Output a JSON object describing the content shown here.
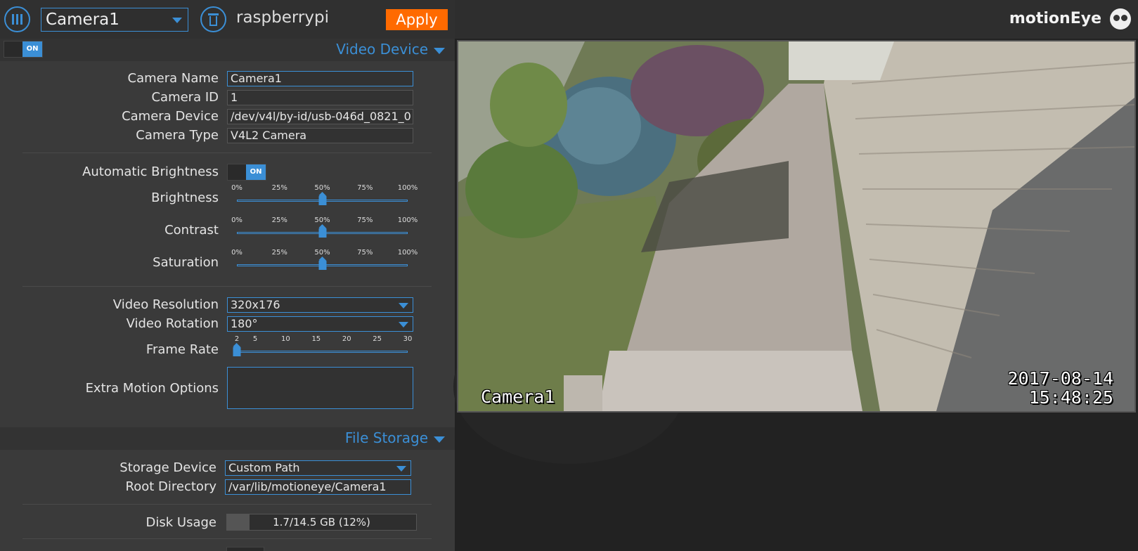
{
  "topbar": {
    "camera_select": "Camera1",
    "host": "raspberrypi",
    "apply": "Apply"
  },
  "brand": {
    "name": "motionEye"
  },
  "camera_enabled": "ON",
  "video_device": {
    "title": "Video Device",
    "camera_name_label": "Camera Name",
    "camera_name": "Camera1",
    "camera_id_label": "Camera ID",
    "camera_id": "1",
    "camera_device_label": "Camera Device",
    "camera_device": "/dev/v4l/by-id/usb-046d_0821_0",
    "camera_type_label": "Camera Type",
    "camera_type": "V4L2 Camera",
    "auto_brightness_label": "Automatic Brightness",
    "auto_brightness": "ON",
    "brightness_label": "Brightness",
    "brightness": 50,
    "contrast_label": "Contrast",
    "contrast": 50,
    "saturation_label": "Saturation",
    "saturation": 50,
    "percent_ticks": [
      "0%",
      "25%",
      "50%",
      "75%",
      "100%"
    ],
    "resolution_label": "Video Resolution",
    "resolution": "320x176",
    "rotation_label": "Video Rotation",
    "rotation": "180°",
    "frame_rate_label": "Frame Rate",
    "frame_rate": 2,
    "frame_rate_ticks": [
      "2",
      "5",
      "10",
      "15",
      "20",
      "25",
      "30"
    ],
    "extra_options_label": "Extra Motion Options"
  },
  "file_storage": {
    "title": "File Storage",
    "storage_device_label": "Storage Device",
    "storage_device": "Custom Path",
    "root_directory_label": "Root Directory",
    "root_directory": "/var/lib/motioneye/Camera1",
    "disk_usage_label": "Disk Usage",
    "disk_usage": "1.7/14.5 GB (12%)",
    "disk_usage_fraction": 0.12
  },
  "camera_overlay": {
    "name": "Camera1",
    "date": "2017-08-14",
    "time": "15:48:25"
  },
  "colors": {
    "accent": "#3b8fd6",
    "apply": "#ff6a00",
    "panel": "#3a3a3a"
  }
}
